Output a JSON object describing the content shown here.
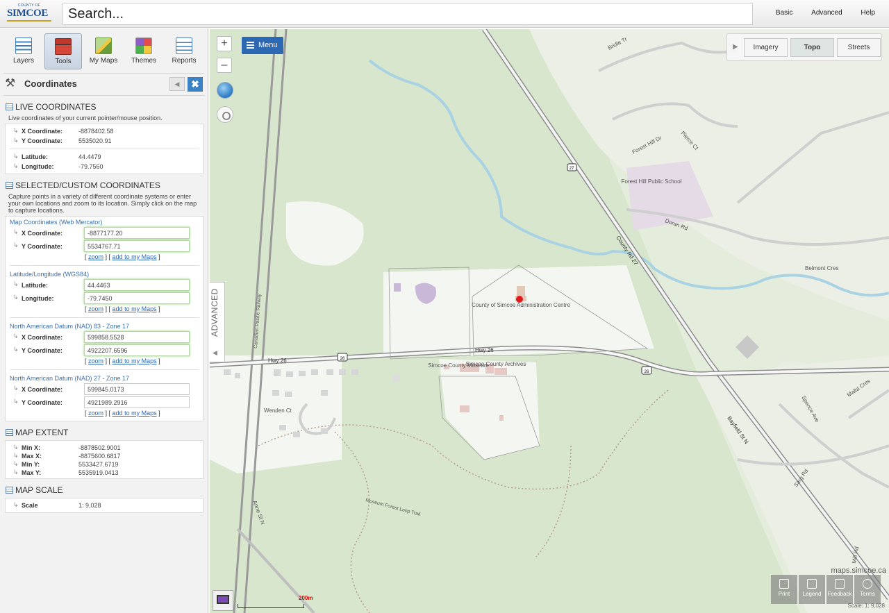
{
  "header": {
    "logo_small": "COUNTY OF",
    "logo_big": "SIMCOE",
    "search_placeholder": "Search...",
    "links": [
      "Basic",
      "Advanced",
      "Help"
    ]
  },
  "sidebar": {
    "tools": [
      {
        "label": "Layers",
        "icon": "layers-icon",
        "color": "#3f7fc1"
      },
      {
        "label": "Tools",
        "icon": "toolbox-icon",
        "color": "#c0392b",
        "active": true
      },
      {
        "label": "My Maps",
        "icon": "map-pencil-icon",
        "color": "#6a9c3c"
      },
      {
        "label": "Themes",
        "icon": "palette-icon",
        "color": "#e0a21d"
      },
      {
        "label": "Reports",
        "icon": "report-icon",
        "color": "#4b7fb5"
      }
    ],
    "panel_title": "Coordinates",
    "live": {
      "heading": "LIVE COORDINATES",
      "description": "Live coordinates of your current pointer/mouse position.",
      "x_label": "X Coordinate:",
      "x_value": "-8878402.58",
      "y_label": "Y Coordinate:",
      "y_value": "5535020.91",
      "lat_label": "Latitude:",
      "lat_value": "44.4479",
      "lon_label": "Longitude:",
      "lon_value": "-79.7560"
    },
    "selected": {
      "heading": "SELECTED/CUSTOM COORDINATES",
      "description": "Capture points in a variety of different coordinate systems or enter your own locations and zoom to its location. Simply click on the map to capture locations.",
      "zoom_link": "zoom",
      "add_link": "add to my Maps",
      "groups": [
        {
          "title": "Map Coordinates (Web Mercator)",
          "l1": "X Coordinate:",
          "v1": "-8877177.20",
          "l2": "Y Coordinate:",
          "v2": "5534767.71"
        },
        {
          "title": "Latitude/Longitude (WGS84)",
          "l1": "Latitude:",
          "v1": "44.4463",
          "l2": "Longitude:",
          "v2": "-79.7450"
        },
        {
          "title": "North American Datum (NAD) 83 - Zone 17",
          "l1": "X Coordinate:",
          "v1": "599858.5528",
          "l2": "Y Coordinate:",
          "v2": "4922207.6596"
        },
        {
          "title": "North American Datum (NAD) 27 - Zone 17",
          "l1": "X Coordinate:",
          "v1": "599845.0173",
          "l2": "Y Coordinate:",
          "v2": "4921989.2916"
        }
      ]
    },
    "extent": {
      "heading": "MAP EXTENT",
      "min_x_label": "Min X:",
      "min_x": "-8878502.9001",
      "max_x_label": "Max X:",
      "max_x": "-8875600.6817",
      "min_y_label": "Min Y:",
      "min_y": "5533427.6719",
      "max_y_label": "Max Y:",
      "max_y": "5535919.0413"
    },
    "scale": {
      "heading": "MAP SCALE",
      "label": "Scale",
      "value": "1: 9,028"
    }
  },
  "map": {
    "menu_label": "Menu",
    "advanced_label": "ADVANCED",
    "basemaps": [
      "Imagery",
      "Topo",
      "Streets"
    ],
    "active_basemap": "Topo",
    "bottom_tools": [
      "Print",
      "Legend",
      "Feedback",
      "Terms"
    ],
    "source": "maps.simcoe.ca",
    "scale_text": "Scale: 1: 9,028",
    "scalebar_label": "200m",
    "labels": {
      "forest_hill_school": "Forest Hill Public School",
      "doran_rd": "Doran Rd",
      "forest_hill_dr": "Forest Hill Dr",
      "pierce_ct": "Pierce Ct",
      "bridle_tr": "Bridle Tr",
      "belmont_cres": "Belmont Cres",
      "admin_centre": "County of Simcoe Administration Centre",
      "museum": "Simcoe County Museum",
      "archives": "Simcoe County Archives",
      "hwy26_a": "Hwy 26",
      "hwy26_b": "Hwy 26",
      "county_rd_27": "County Rd 27",
      "cpr": "Canadian Pacific Railway",
      "wenden_ct": "Wenden Ct",
      "anne_st": "Anne St N",
      "bayfield_st": "Bayfield St N",
      "museum_trail": "Museum Forest Loop Trail",
      "spence_ave": "Spence Ave",
      "malta_cres": "Malta Cres",
      "sarg_rd": "Sarg Rd",
      "mill_rd": "Mill Rd",
      "shield_26a": "26",
      "shield_26b": "26",
      "shield_27": "27"
    }
  }
}
